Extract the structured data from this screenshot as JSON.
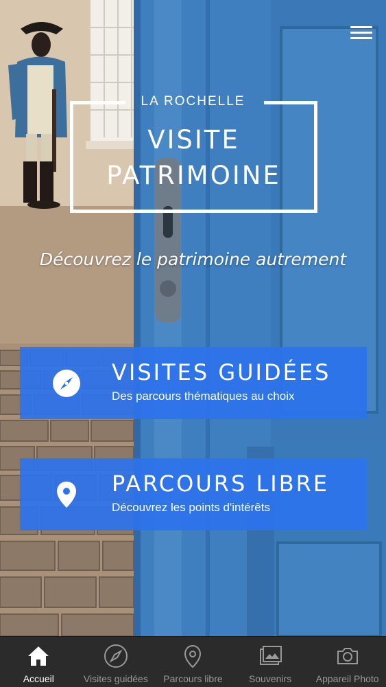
{
  "header": {
    "city": "LA ROCHELLE",
    "title_line1": "VISITE",
    "title_line2": "PATRIMOINE",
    "tagline": "Découvrez le patrimoine autrement"
  },
  "menu": {
    "icon": "hamburger-menu-icon"
  },
  "cards": [
    {
      "title": "VISITES GUIDÉES",
      "subtitle": "Des parcours thématiques au choix",
      "icon": "compass-icon"
    },
    {
      "title": "PARCOURS LIBRE",
      "subtitle": "Découvrez les points d'intérêts",
      "icon": "map-pin-icon"
    }
  ],
  "tabbar": {
    "tabs": [
      {
        "label": "Accueil",
        "icon": "home-icon",
        "active": true
      },
      {
        "label": "Visites guidées",
        "icon": "compass-icon",
        "active": false
      },
      {
        "label": "Parcours libre",
        "icon": "map-pin-icon",
        "active": false
      },
      {
        "label": "Souvenirs",
        "icon": "photos-icon",
        "active": false
      },
      {
        "label": "Appareil Photo",
        "icon": "camera-icon",
        "active": false
      }
    ]
  },
  "colors": {
    "card_blue": "#2d73eb",
    "door_blue": "#3f7fbf",
    "tabbar_bg": "#2b2b2b",
    "tab_inactive": "#9a9a9a",
    "tab_active": "#ffffff"
  }
}
